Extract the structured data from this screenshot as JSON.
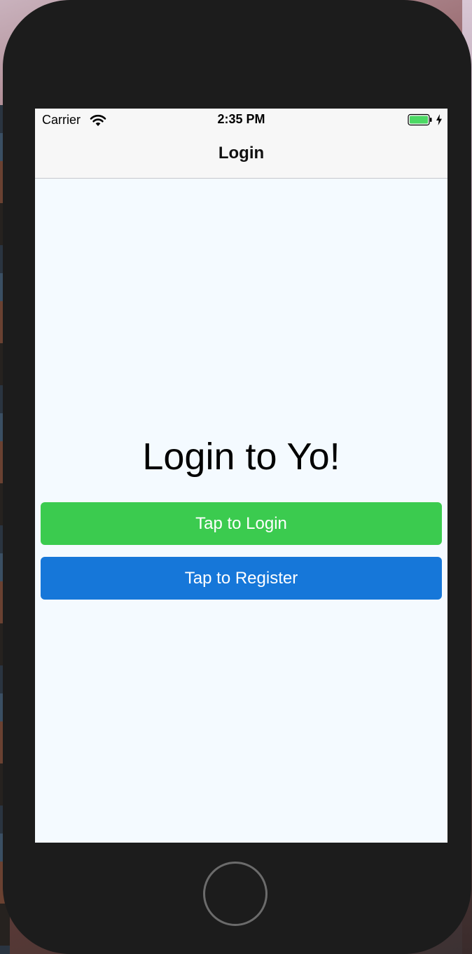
{
  "status_bar": {
    "carrier": "Carrier",
    "time": "2:35 PM",
    "wifi_icon": "wifi-icon",
    "battery_icon": "battery-full-icon",
    "charging_icon": "charging-bolt-icon",
    "battery_color": "#4cd964"
  },
  "nav_bar": {
    "title": "Login"
  },
  "main": {
    "headline": "Login to Yo!",
    "login_button": {
      "label": "Tap to Login",
      "color": "#3bcb4f"
    },
    "register_button": {
      "label": "Tap to Register",
      "color": "#1677d9"
    },
    "background_color": "#f4faff"
  },
  "device": {
    "home_button_icon": "home-button-icon"
  }
}
